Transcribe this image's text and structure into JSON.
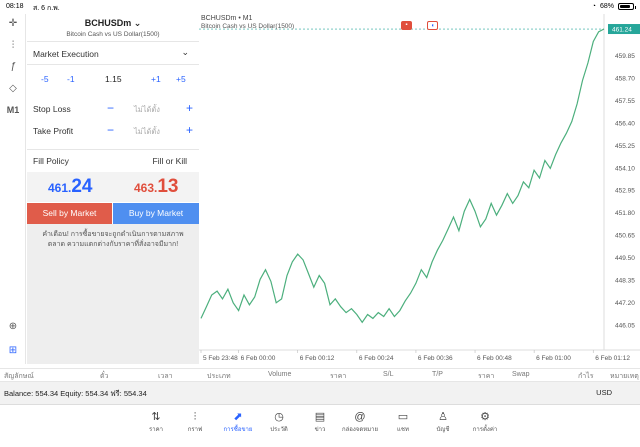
{
  "status_bar": {
    "time": "08:18",
    "date": "ส. 6 ก.พ.",
    "battery": "68%",
    "battery_level": 0.68
  },
  "order": {
    "symbol": "BCHUSDm",
    "description": "Bitcoin Cash vs US Dollar(1500)",
    "execution": "Market Execution",
    "volume_steps": {
      "minus5": "-5",
      "minus1": "-1",
      "value": "1.15",
      "plus1": "+1",
      "plus5": "+5"
    },
    "stop_loss": {
      "label": "Stop Loss",
      "placeholder": "ไม่ได้ตั้ง"
    },
    "take_profit": {
      "label": "Take Profit",
      "placeholder": "ไม่ได้ตั้ง"
    },
    "fill_policy": {
      "label": "Fill Policy",
      "value": "Fill or Kill"
    },
    "bid": {
      "main": "461.",
      "big": "24"
    },
    "ask": {
      "main": "463.",
      "big": "13"
    },
    "sell_label": "Sell by Market",
    "buy_label": "Buy by Market",
    "warning": "คำเตือน! การซื้อขายจะถูกดำเนินการตามสภาพตลาด ความแตกต่างกับราคาที่สั่งอาจมีมาก!"
  },
  "chart": {
    "title": "BCHUSDm • M1",
    "description": "Bitcoin Cash vs US Dollar(1500)",
    "current_price": "461.24",
    "colors": {
      "line": "#4caf7d",
      "price_tag": "#26a69a",
      "bid": "#2962ff",
      "ask": "#e04e3c"
    }
  },
  "chart_data": {
    "type": "line",
    "x": [
      "5 Feb 23:48",
      "",
      "",
      "",
      "",
      "",
      "",
      "6 Feb 00:00",
      "",
      "",
      "",
      "",
      "",
      "",
      "",
      "",
      "",
      "",
      "6 Feb 00:12",
      "",
      "",
      "",
      "",
      "",
      "",
      "",
      "",
      "",
      "",
      "6 Feb 00:24",
      "",
      "",
      "",
      "",
      "",
      "",
      "",
      "",
      "",
      "",
      "6 Feb 00:36",
      "",
      "",
      "",
      "",
      "",
      "",
      "",
      "",
      "",
      "",
      "6 Feb 00:48",
      "",
      "",
      "",
      "",
      "",
      "",
      "",
      "",
      "",
      "",
      "6 Feb 01:00",
      "",
      "",
      "",
      "",
      "",
      "",
      "",
      "",
      "",
      "",
      "6 Feb 01:12",
      ""
    ],
    "y_ticks": [
      "461.24",
      "459.85",
      "458.70",
      "457.55",
      "456.40",
      "455.25",
      "454.10",
      "452.95",
      "451.80",
      "450.65",
      "449.50",
      "448.35",
      "447.20",
      "446.05"
    ],
    "x_ticks": [
      "5 Feb 23:48",
      "6 Feb 00:00",
      "6 Feb 00:12",
      "6 Feb 00:24",
      "6 Feb 00:36",
      "6 Feb 00:48",
      "6 Feb 01:00",
      "6 Feb 01:12"
    ],
    "ylim": [
      445.5,
      461.6
    ],
    "values": [
      446.4,
      447.0,
      447.6,
      447.8,
      447.4,
      447.9,
      447.2,
      446.8,
      447.6,
      447.1,
      447.5,
      448.4,
      448.9,
      448.3,
      447.2,
      447.4,
      448.6,
      449.3,
      449.7,
      449.4,
      448.7,
      448.0,
      448.6,
      448.2,
      447.1,
      447.4,
      447.0,
      446.7,
      446.9,
      446.6,
      446.2,
      446.6,
      446.4,
      446.7,
      446.5,
      446.9,
      446.5,
      446.8,
      447.3,
      447.7,
      448.2,
      448.9,
      448.5,
      449.3,
      449.9,
      450.4,
      451.0,
      451.6,
      450.9,
      451.9,
      452.5,
      451.9,
      451.1,
      451.5,
      452.3,
      451.7,
      452.2,
      452.8,
      452.3,
      452.7,
      453.4,
      453.1,
      454.0,
      453.6,
      454.5,
      454.1,
      454.8,
      455.4,
      455.9,
      456.5,
      457.4,
      458.6,
      459.5,
      460.6,
      461.1,
      461.24
    ],
    "grid": false
  },
  "positions_header": [
    "สัญลักษณ์",
    "ตั๋ว",
    "เวลา",
    "ประเภท",
    "Volume",
    "ราคา",
    "S/L",
    "T/P",
    "ราคา",
    "Swap",
    "กำไร",
    "หมายเหตุ"
  ],
  "balance": {
    "text": "Balance: 554.34 Equity: 554.34 ฟรี: 554.34",
    "currency": "USD"
  },
  "tabs": [
    {
      "label": "ราคา",
      "icon": "quotes-icon"
    },
    {
      "label": "กราฟ",
      "icon": "charts-icon"
    },
    {
      "label": "การซื้อขาย",
      "icon": "trade-icon"
    },
    {
      "label": "ประวัติ",
      "icon": "history-icon"
    },
    {
      "label": "ข่าว",
      "icon": "news-icon"
    },
    {
      "label": "กล่องจดหมาย",
      "icon": "mailbox-icon"
    },
    {
      "label": "แชท",
      "icon": "chat-icon"
    },
    {
      "label": "บัญชี",
      "icon": "accounts-icon"
    },
    {
      "label": "การตั้งค่า",
      "icon": "settings-icon"
    }
  ]
}
